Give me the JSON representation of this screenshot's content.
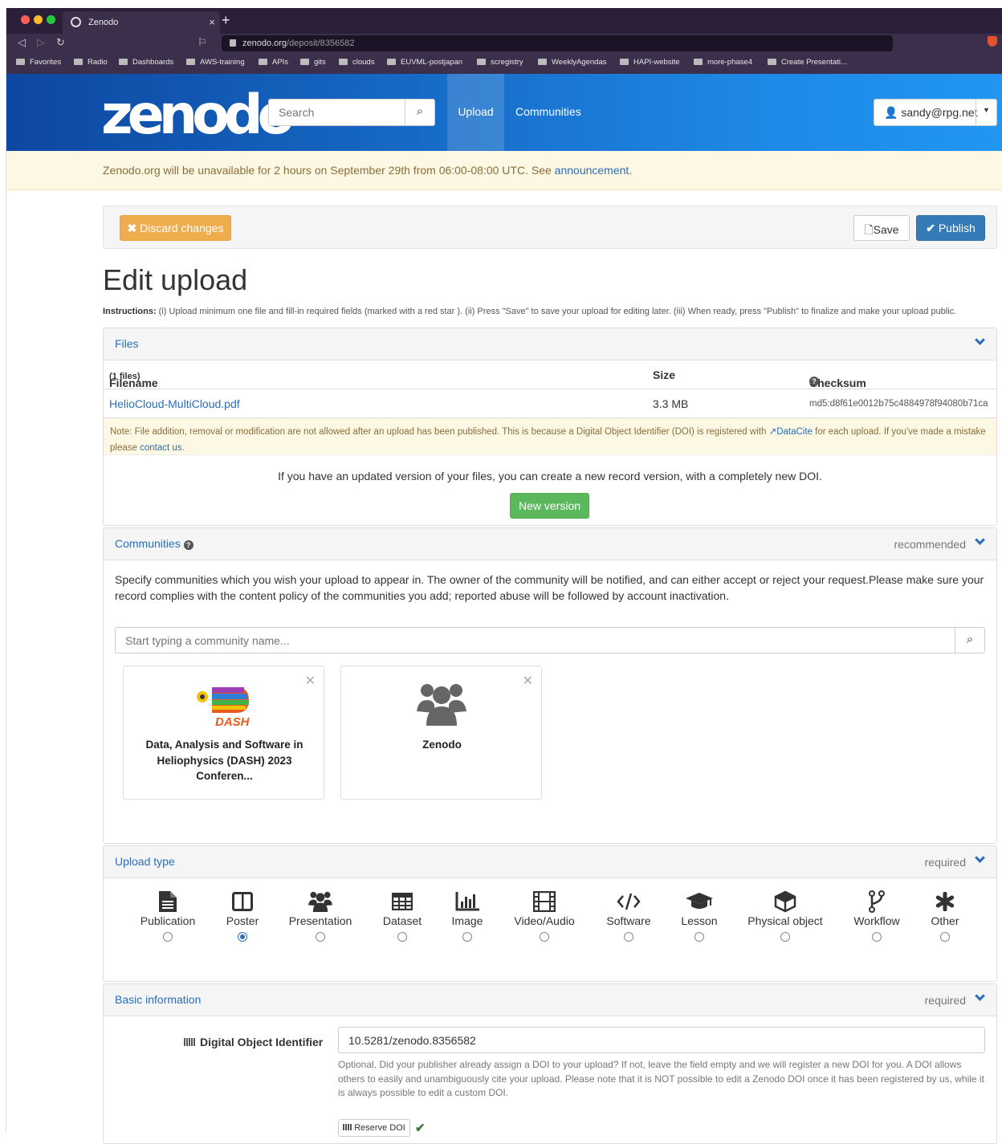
{
  "browser": {
    "tab_title": "Zenodo",
    "tab_close": "×",
    "new_tab": "+",
    "url_host": "zenodo.org",
    "url_path": "/deposit/8356582",
    "bookmarks": [
      "Favorites",
      "Radio",
      "Dashboards",
      "AWS-training",
      "APIs",
      "gits",
      "clouds",
      "EUVML-postjapan",
      "scregistry",
      "WeeklyAgendas",
      "HAPI-website",
      "more-phase4",
      "Create Presentati..."
    ]
  },
  "header": {
    "logo": "zenodo",
    "search_placeholder": "Search",
    "nav_upload": "Upload",
    "nav_communities": "Communities",
    "user": "sandy@rpg.net"
  },
  "notice": {
    "text": "Zenodo.org will be unavailable for 2 hours on September 29th from 06:00-08:00 UTC. See ",
    "link": "announcement",
    "after": "."
  },
  "toolbar": {
    "discard": "Discard changes",
    "save": "Save",
    "publish": "Publish"
  },
  "page": {
    "title": "Edit upload",
    "instructions_label": "Instructions:",
    "instructions": " (i) Upload minimum one file and fill-in required fields (marked with a red star ). (ii) Press \"Save\" to save your upload for editing later. (iii) When ready, press \"Publish\" to finalize and make your upload public."
  },
  "files": {
    "heading": "Files",
    "col_filename": "Filename",
    "col_count": "(1 files)",
    "col_size": "Size",
    "col_checksum": "Checksum",
    "rows": [
      {
        "name": "HelioCloud-MultiCloud.pdf",
        "size": "3.3 MB",
        "checksum": "md5:d8f61e0012b75c4884978f94080b71ca"
      }
    ],
    "note_before": "Note: File addition, removal or modification are not allowed after an upload has been published. This is because a Digital Object Identifier (DOI) is registered with ",
    "note_link": "DataCite",
    "note_after": " for each upload. If you've made a mistake please ",
    "note_contact": "contact us",
    "note_end": ".",
    "new_version_text": "If you have an updated version of your files, you can create a new record version, with a completely new DOI.",
    "new_version_button": "New version"
  },
  "communities": {
    "heading": "Communities",
    "badge": "recommended",
    "description": "Specify communities which you wish your upload to appear in. The owner of the community will be notified, and can either accept or reject your request.Please make sure your record complies with the content policy of the communities you add; reported abuse will be followed by account inactivation.",
    "search_placeholder": "Start typing a community name...",
    "cards": [
      {
        "name": "Data, Analysis and Software in Heliophysics (DASH) 2023 Conferen...",
        "logo_text": "DASH"
      },
      {
        "name": "Zenodo"
      }
    ]
  },
  "upload_type": {
    "heading": "Upload type",
    "badge": "required",
    "types": [
      {
        "label": "Publication",
        "icon": "file-icon",
        "selected": false
      },
      {
        "label": "Poster",
        "icon": "columns-icon",
        "selected": true
      },
      {
        "label": "Presentation",
        "icon": "group-icon",
        "selected": false
      },
      {
        "label": "Dataset",
        "icon": "table-icon",
        "selected": false
      },
      {
        "label": "Image",
        "icon": "bar-chart-icon",
        "selected": false
      },
      {
        "label": "Video/Audio",
        "icon": "film-icon",
        "selected": false
      },
      {
        "label": "Software",
        "icon": "code-icon",
        "selected": false
      },
      {
        "label": "Lesson",
        "icon": "graduation-cap-icon",
        "selected": false
      },
      {
        "label": "Physical object",
        "icon": "cube-icon",
        "selected": false
      },
      {
        "label": "Workflow",
        "icon": "code-fork-icon",
        "selected": false
      },
      {
        "label": "Other",
        "icon": "asterisk-icon",
        "selected": false
      }
    ]
  },
  "basic_info": {
    "heading": "Basic information",
    "badge": "required",
    "doi_label": "Digital Object Identifier",
    "doi_value": "10.5281/zenodo.8356582",
    "doi_help": "Optional. Did your publisher already assign a DOI to your upload? If not, leave the field empty and we will register a new DOI for you. A DOI allows others to easily and unambiguously cite your upload. Please note that it is NOT possible to edit a Zenodo DOI once it has been registered by us, while it is always possible to edit a custom DOI.",
    "reserve_button": "Reserve DOI"
  },
  "colors": {
    "link": "#2a6ebb",
    "warning": "#f0ad4e",
    "primary": "#337ab7",
    "success": "#5cb85c"
  }
}
